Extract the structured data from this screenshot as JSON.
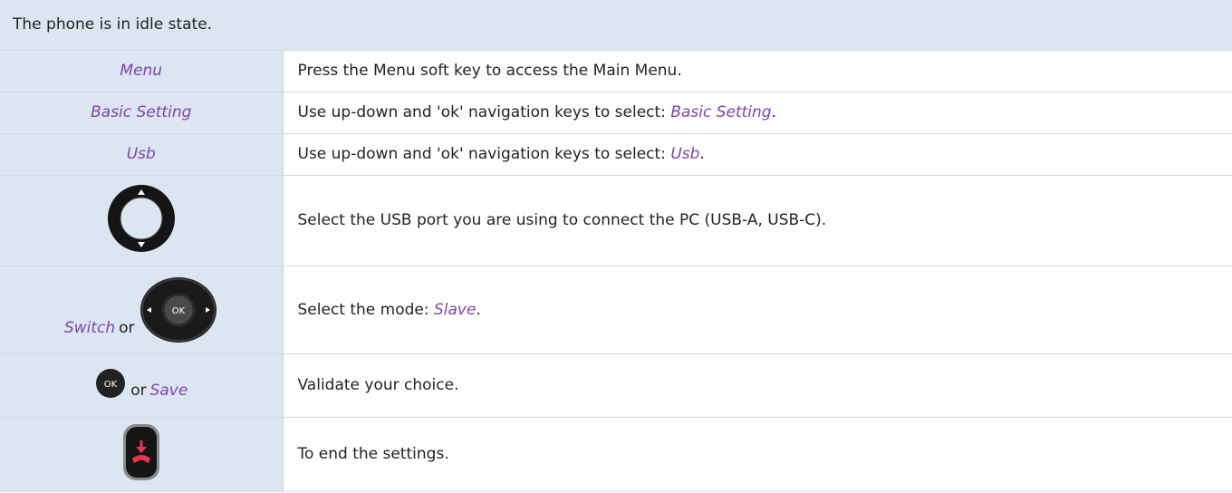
{
  "header": {
    "text": "The phone is in idle state."
  },
  "rows": [
    {
      "key_text": "Menu",
      "desc": "Press the Menu soft key to access the Main Menu."
    },
    {
      "key_text": "Basic Setting",
      "desc_prefix": "Use up-down and 'ok' navigation keys to select: ",
      "desc_italic": "Basic Setting",
      "desc_suffix": "."
    },
    {
      "key_text": "Usb",
      "desc_prefix": "Use up-down and 'ok' navigation keys to select: ",
      "desc_italic": "Usb",
      "desc_suffix": "."
    },
    {
      "icon": "navigator-up-down-icon",
      "desc": "Select the USB port you are using to connect the PC (USB-A, USB-C)."
    },
    {
      "key_text": "Switch",
      "connector": "or",
      "icon": "navigator-ok-icon",
      "icon_label": "OK",
      "desc_prefix": "Select the mode: ",
      "desc_italic": "Slave",
      "desc_suffix": "."
    },
    {
      "icon": "ok-button-icon",
      "icon_label": "OK",
      "connector": "or",
      "key_text": "Save",
      "desc": "Validate your choice."
    },
    {
      "icon": "hang-up-key-icon",
      "desc": "To end the settings."
    }
  ],
  "colors": {
    "accent": "#7f43aa",
    "key_cell_bg": "#dce5f2",
    "border": "#d2d8e2",
    "hangup_red": "#e8344f"
  }
}
